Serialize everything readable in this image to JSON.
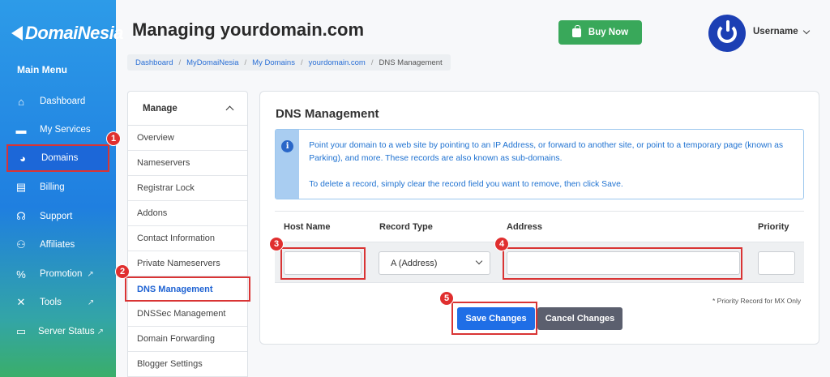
{
  "brand": {
    "logo_text": "DomaiNesia"
  },
  "sidebar": {
    "menu_title": "Main Menu",
    "items": [
      {
        "label": "Dashboard",
        "icon": "home-icon"
      },
      {
        "label": "My Services",
        "icon": "server-icon"
      },
      {
        "label": "Domains",
        "icon": "globe-icon",
        "active": true
      },
      {
        "label": "Billing",
        "icon": "invoice-icon"
      },
      {
        "label": "Support",
        "icon": "headset-icon"
      },
      {
        "label": "Affiliates",
        "icon": "users-icon"
      },
      {
        "label": "Promotion",
        "icon": "percent-icon",
        "external": true
      },
      {
        "label": "Tools",
        "icon": "tools-icon",
        "external": true
      },
      {
        "label": "Server Status",
        "icon": "monitor-icon",
        "external": true
      }
    ]
  },
  "header": {
    "title": "Managing yourdomain.com",
    "buy_label": "Buy Now",
    "username": "Username"
  },
  "breadcrumb": [
    "Dashboard",
    "MyDomaiNesia",
    "My Domains",
    "yourdomain.com",
    "DNS Management"
  ],
  "manage": {
    "title": "Manage",
    "items": [
      "Overview",
      "Nameservers",
      "Registrar Lock",
      "Addons",
      "Contact Information",
      "Private Nameservers",
      "DNS Management",
      "DNSSec Management",
      "Domain Forwarding",
      "Blogger Settings"
    ],
    "active_index": 6
  },
  "dns": {
    "title": "DNS Management",
    "info_line1": "Point your domain to a web site by pointing to an IP Address, or forward to another site, or point to a temporary page (known as Parking), and more. These records are also known as sub-domains.",
    "info_line2": "To delete a record, simply clear the record field you want to remove, then click Save.",
    "columns": [
      "Host Name",
      "Record Type",
      "Address",
      "Priority"
    ],
    "record_type_selected": "A (Address)",
    "host_value": "",
    "address_value": "",
    "priority_value": "",
    "mx_note": "* Priority Record for MX Only",
    "save_label": "Save Changes",
    "cancel_label": "Cancel Changes"
  },
  "markers": [
    "1",
    "2",
    "3",
    "4",
    "5"
  ],
  "colors": {
    "accent": "#1f6ee6",
    "success": "#39a85a",
    "highlight": "#d93434"
  }
}
